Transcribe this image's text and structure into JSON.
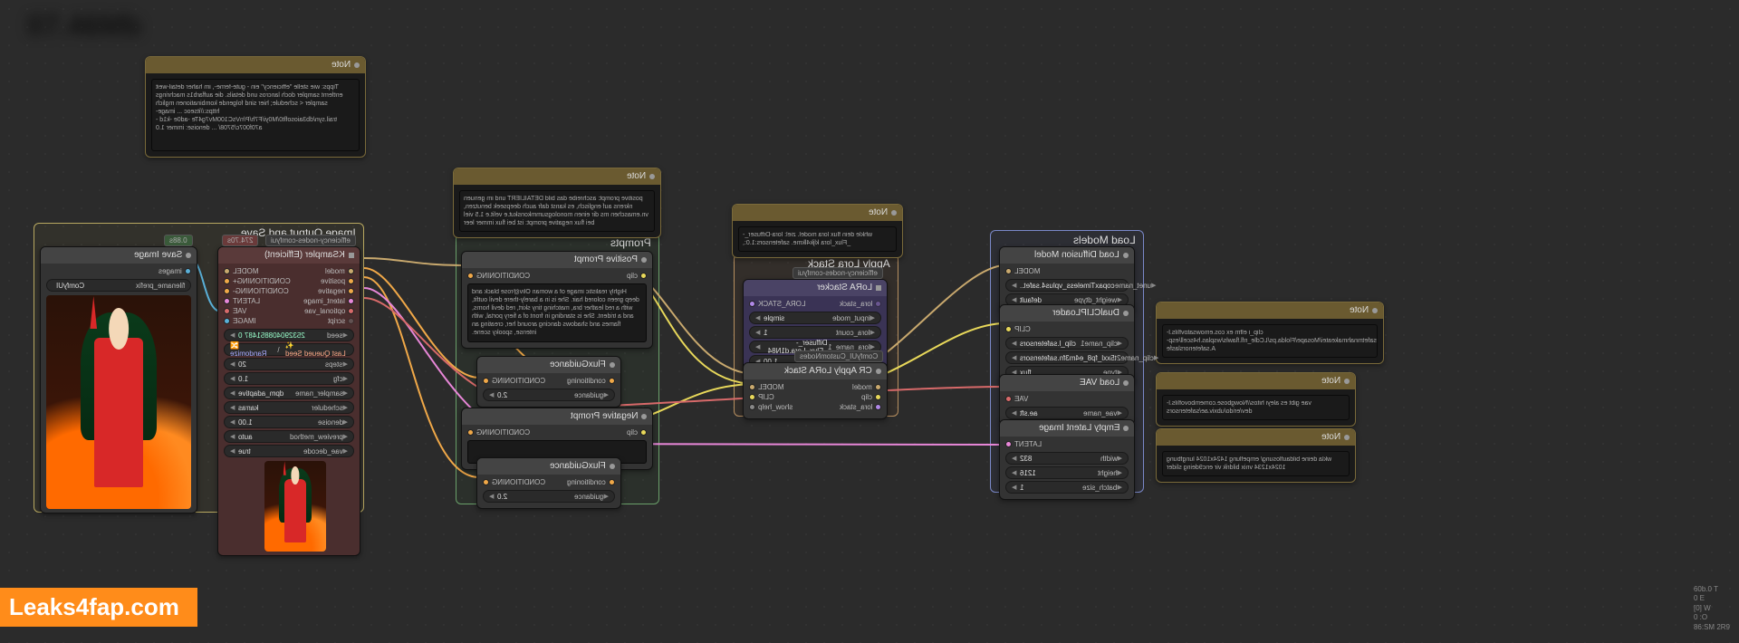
{
  "watermark": "Leaks4fap.com",
  "top_left_blurred": "07.46Mb",
  "stats": {
    "l1": "60b.0 T",
    "l2": "0 E",
    "l3": "[0] W",
    "l4": "0 :O",
    "l5": "86:SM 2R9"
  },
  "groups": {
    "load_models": {
      "title": "Load Models"
    },
    "apply_lora": {
      "title": "Apply Lora Stack"
    },
    "prompts": {
      "title": "Prompts"
    },
    "output": {
      "title": "Image Output and Save"
    }
  },
  "notes": {
    "top_right": {
      "title": "Note",
      "text": "Tipps: wie stelle \"efficiency\" ein - gute-ferne-, im haher detail-weit entfernt sampler doch lancros und details. die auffarb1s machrings sampler < schedule; hier sind folgende kombinationen mglich https://itseoc ... image-trail.syn/db3aiosoflt0/M0yi/F7h/P/nVsC100Mv7g4Te -ad0e -k1d -a70f007c/5708/ ...\n\ndenoise: immer 1.0"
    },
    "mid": {
      "title": "Note",
      "text": "positive prompt: aschreibe das bild DETAILIERT und im genuen nkrens auf englisch, es kanst dafr auch deepseek benutzen, vn.emaschen ms dir einen monologsummkonskut.e velit.e 1.5 viel bei flux\n\nnegative prompt: ist bei flux immer leer"
    },
    "models_note": {
      "title": "Note",
      "text": "whkle dein flux lora model. ziel:\nlora-Diffuser_-_Flux_lora kljk4lkme. safetensors:1.0:,"
    },
    "clip_note": {
      "title": "Note",
      "text": "clip_i elfm ex\ncos.emowsatovflils.l-alv/reviesi/waUxfelp_i.safetmnahmakeatei/Mosape/Flolda.ps/LCdle_nfl.flawls/wsplas.h4scell/esp-A.safetenorslasfe"
    },
    "vae_note": {
      "title": "Note",
      "text": "vae gibt es aleyi\nhitos//Nowgbose.comembovoflils.l-dev/erido/ubxiv.ae/safetensors"
    },
    "latent_note": {
      "title": "Note",
      "text": "wkla deine bildauflosung/ empeflung 1424x1024 lungfbung 1024x1234 vnix bildrik vir enc9deing slider"
    }
  },
  "nodes": {
    "load_diffusion": {
      "title": "Load Diffusion Model",
      "out_model": "MODEL",
      "w_unet_name": {
        "name": "unet_name",
        "value": "copaxTimeless_vplus4.safet.."
      },
      "w_weight_dtype": {
        "name": "weight_dtype",
        "value": "default"
      }
    },
    "dual_clip": {
      "title": "DualCLIPLoader",
      "out_clip": "CLIP",
      "w_clip1": {
        "name": "clip_name1",
        "value": "clip_l.safetensors"
      },
      "w_clip2": {
        "name": "clip_name2",
        "value": "t5xxl_fp8_e4m3fn.safetensors"
      },
      "w_type": {
        "name": "type",
        "value": "flux"
      }
    },
    "load_vae": {
      "title": "Load VAE",
      "out_vae": "VAE",
      "w_vae": {
        "name": "vae_name",
        "value": "ae.sft"
      }
    },
    "empty_latent": {
      "title": "Empty Latent Image",
      "out_latent": "LATENT",
      "w_width": {
        "name": "width",
        "value": "832"
      },
      "w_height": {
        "name": "height",
        "value": "1216"
      },
      "w_batch": {
        "name": "batch_size",
        "value": "1"
      }
    },
    "lora_stacker": {
      "title": "LoRA Stacker",
      "badge": "efficiency-nodes-comfyui",
      "in_lora": "lora_stack",
      "out_lora": "LORA_STACK",
      "w_input_mode": {
        "name": "input_mode",
        "value": "simple"
      },
      "w_lora_count": {
        "name": "lora_count",
        "value": "1"
      },
      "w_lora_name": {
        "name": "lora_name_1",
        "value": "Diffuser_-_Flux_Lora.d1N84"
      },
      "w_lora_wt": {
        "name": "lora_wt_1",
        "value": "1.00"
      }
    },
    "cr_apply_lora": {
      "title": "CR Apply LoRA Stack",
      "badge": "ComfyUI_CustomNodes",
      "in_model": "model",
      "in_clip": "clip",
      "in_lora": "lora_stack",
      "out_model": "MODEL",
      "out_clip": "CLIP",
      "out_help": "show_help"
    },
    "pos_prompt": {
      "title": "Positive Prompt",
      "in_clip": "clip",
      "out_cond": "CONDITIONING",
      "text": "Highly realistic image of a woman Oliv@rose black and deep green colored hair. She is in a barely-there devil outfit, with a red leather bra, matching tiny skirt, red devil horns, and a trident. She is standing in front of a fiery portal, with flames and shadows dancing around her, creating an intense, spooky scene."
    },
    "neg_prompt": {
      "title": "Negative Prompt",
      "in_clip": "clip",
      "out_cond": "CONDITIONING",
      "text": ""
    },
    "flux_guid_pos": {
      "title": "FluxGuidance",
      "in_cond": "conditioning",
      "out_cond": "CONDITIONING",
      "w_guidance": {
        "name": "guidance",
        "value": "2.0"
      }
    },
    "flux_guid_neg": {
      "title": "FluxGuidance",
      "in_cond": "conditioning",
      "out_cond": "CONDITIONING",
      "w_guidance": {
        "name": "guidance",
        "value": "2.0"
      }
    },
    "ksampler": {
      "title": "KSampler (Efficient)",
      "badge": "efficiency-nodes-comfyui",
      "time": "274.70s",
      "in_model": "model",
      "in_pos": "positive",
      "in_neg": "negative",
      "in_latent": "latent_image",
      "in_vae": "optional_vae",
      "in_script": "script",
      "out_model": "MODEL",
      "out_pos": "CONDITIONING+",
      "out_neg": "CONDITIONING-",
      "out_latent": "LATENT",
      "out_vae": "VAE",
      "out_image": "IMAGE",
      "w_seed": {
        "name": "seed",
        "value": "253290408851487",
        "extra": "0"
      },
      "w_seed_ctrl": {
        "left": "Randomize",
        "right": "Last Queued Seed"
      },
      "w_steps": {
        "name": "steps",
        "value": "20"
      },
      "w_cfg": {
        "name": "cfg",
        "value": "1.0"
      },
      "w_sampler": {
        "name": "sampler_name",
        "value": "dpm_adaptive"
      },
      "w_scheduler": {
        "name": "scheduler",
        "value": "karras"
      },
      "w_denoise": {
        "name": "denoise",
        "value": "1.00"
      },
      "w_preview": {
        "name": "preview_method",
        "value": "auto"
      },
      "w_vae_dec": {
        "name": "vae_decode",
        "value": "true"
      }
    },
    "save_image": {
      "title": "Save Image",
      "time": "0.88s",
      "in_images": "images",
      "w_prefix": {
        "name": "filename_prefix",
        "value": "ComfyUI"
      }
    }
  }
}
